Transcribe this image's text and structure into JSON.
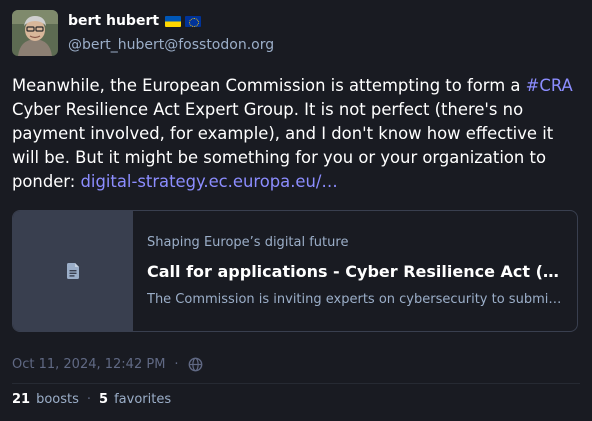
{
  "author": {
    "display_name": "bert hubert",
    "handle": "@bert_hubert@fosstodon.org",
    "avatar_icon": "user-avatar",
    "flags": [
      "ukraine-flag-icon",
      "eu-flag-icon"
    ]
  },
  "post": {
    "text_before": "Meanwhile, the European Commission is attempting to form a ",
    "hashtag": "#CRA",
    "text_after": " Cyber Resilience Act Expert Group. It is not perfect (there's no payment involved, for example), and I don't know how effective it will be. But it might be something for you or your organization to ponder: ",
    "link_text": "digital-strategy.ec.europa.eu/…"
  },
  "card": {
    "provider": "Shaping Europe’s digital future",
    "title": "Call for applications - Cyber Resilience Act (CRA) Expert Group",
    "description": "The Commission is inviting experts on cybersecurity to submit their applications",
    "thumb_icon": "document-icon"
  },
  "meta": {
    "timestamp": "Oct 11, 2024, 12:42 PM",
    "separator": "·",
    "visibility_icon": "globe-icon"
  },
  "stats": {
    "boosts_count": "21",
    "boosts_label": "boosts",
    "separator": "·",
    "favorites_count": "5",
    "favorites_label": "favorites"
  },
  "colors": {
    "background": "#191b22",
    "link": "#8c8dff",
    "muted": "#9baec8",
    "dim": "#606984",
    "card_border": "#393f4f"
  }
}
